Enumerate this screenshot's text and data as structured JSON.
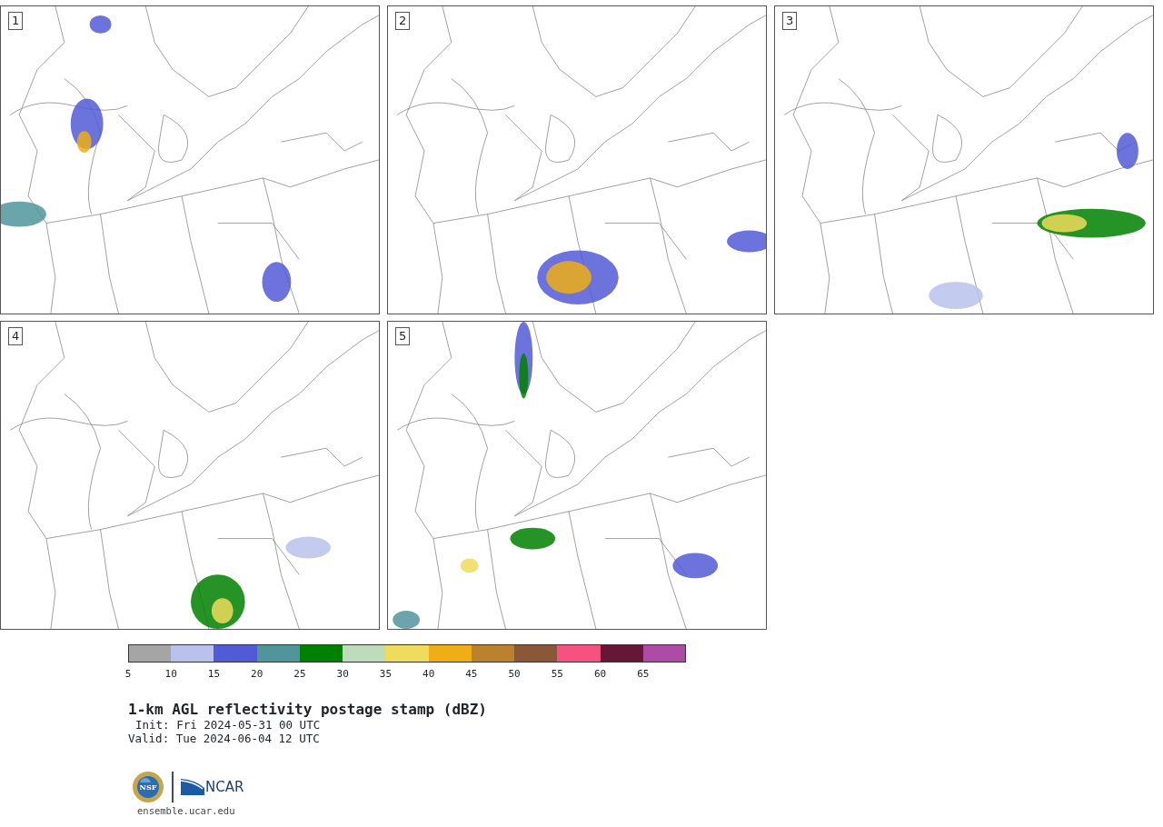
{
  "panels": [
    {
      "label": "1"
    },
    {
      "label": "2"
    },
    {
      "label": "3"
    },
    {
      "label": "4"
    },
    {
      "label": "5"
    }
  ],
  "colorbar": {
    "segments": [
      {
        "tick": "5",
        "color": "#a5a5a5"
      },
      {
        "tick": "10",
        "color": "#b8c2ec"
      },
      {
        "tick": "15",
        "color": "#525bd6"
      },
      {
        "tick": "20",
        "color": "#4f959b"
      },
      {
        "tick": "25",
        "color": "#008000"
      },
      {
        "tick": "30",
        "color": "#bedcbc"
      },
      {
        "tick": "35",
        "color": "#efdc5c"
      },
      {
        "tick": "40",
        "color": "#efae16"
      },
      {
        "tick": "45",
        "color": "#bb812f"
      },
      {
        "tick": "50",
        "color": "#895838"
      },
      {
        "tick": "55",
        "color": "#f65280"
      },
      {
        "tick": "60",
        "color": "#651735"
      },
      {
        "tick": "65",
        "color": "#ad4ba6"
      }
    ]
  },
  "title": "1-km AGL reflectivity postage stamp (dBZ)",
  "init": "Init: Fri 2024-05-31 00 UTC",
  "valid": "Valid: Tue 2024-06-04 12 UTC",
  "footer": {
    "logo_left": "NSF",
    "logo_right": "NCAR",
    "url": "ensemble.ucar.edu"
  }
}
